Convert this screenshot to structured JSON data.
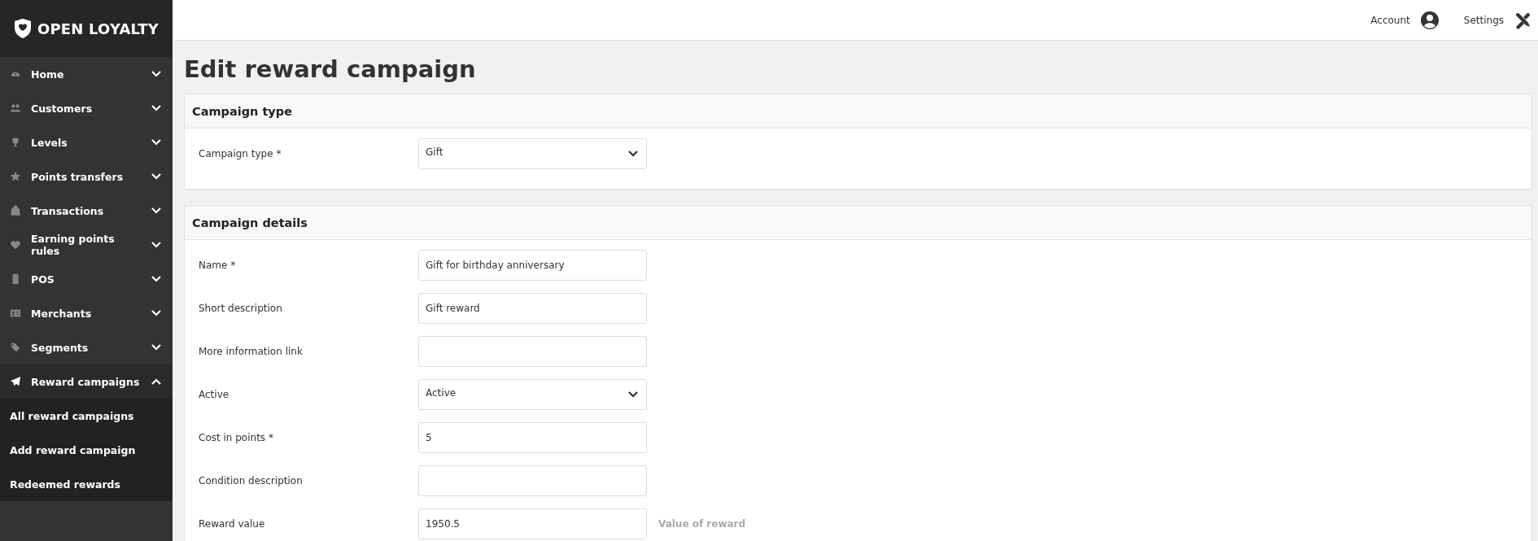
{
  "sidebar": {
    "logo": "OPEN LOYALTY",
    "items": [
      {
        "label": "Home",
        "expanded": false
      },
      {
        "label": "Customers",
        "expanded": false
      },
      {
        "label": "Levels",
        "expanded": false
      },
      {
        "label": "Points transfers",
        "expanded": false
      },
      {
        "label": "Transactions",
        "expanded": false
      },
      {
        "label": "Earning points rules",
        "expanded": false
      },
      {
        "label": "POS",
        "expanded": false
      },
      {
        "label": "Merchants",
        "expanded": false
      },
      {
        "label": "Segments",
        "expanded": false
      },
      {
        "label": "Reward campaigns",
        "expanded": true,
        "children": [
          {
            "label": "All reward campaigns"
          },
          {
            "label": "Add reward campaign"
          },
          {
            "label": "Redeemed rewards"
          }
        ]
      }
    ]
  },
  "top_bar": {
    "account": "Account",
    "settings": "Settings"
  },
  "page_title": "Edit reward campaign",
  "cards": [
    {
      "title": "Campaign type",
      "fields": [
        {
          "label": "Campaign type *",
          "kind": "select",
          "value": "Gift"
        }
      ]
    },
    {
      "title": "Campaign details",
      "fields": [
        {
          "label": "Name *",
          "kind": "text",
          "value": "Gift for birthday anniversary"
        },
        {
          "label": "Short description",
          "kind": "text",
          "value": "Gift reward"
        },
        {
          "label": "More information link",
          "kind": "text"
        },
        {
          "label": "Active",
          "kind": "select",
          "value": "Active"
        },
        {
          "label": "Cost in points *",
          "kind": "text",
          "value": "5"
        },
        {
          "label": "Condition description",
          "kind": "text"
        },
        {
          "label": "Reward value",
          "kind": "text",
          "value": "1950.5",
          "hint": "Value of reward"
        }
      ]
    }
  ]
}
